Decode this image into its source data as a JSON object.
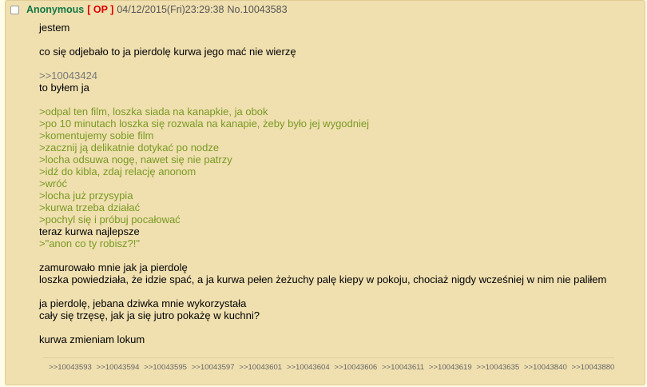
{
  "post": {
    "name": "Anonymous",
    "op_tag": "[ OP ]",
    "date": "04/12/2015(Fri)23:29:38",
    "number": "No.10043583"
  },
  "body": {
    "l1": "jestem",
    "l2": "co się odjebało to ja pierdolę kurwa jego mać nie wierzę",
    "quote": ">>10043424",
    "l3": "to byłem ja",
    "g1": ">odpal ten film, loszka siada na kanapkie, ja obok",
    "g2": ">po 10 minutach loszka się rozwala na kanapie, żeby było jej wygodniej",
    "g3": ">komentujemy sobie film",
    "g4": ">zacznij ją delikatnie dotykać po nodze",
    "g5": ">locha odsuwa nogę, nawet się nie patrzy",
    "g6": ">idź do kibla, zdaj relację anonom",
    "g7": ">wróć",
    "g8": ">locha już przysypia",
    "g9": ">kurwa trzeba działać",
    "g10": ">pochyl się i próbuj pocałować",
    "l4": "teraz kurwa najlepsze",
    "g11": ">\"anon co ty robisz?!\"",
    "l5": "zamurowało mnie jak ja pierdolę",
    "l6": "loszka powiedziała, że idzie spać, a ja kurwa pełen żeżuchy palę kiepy w pokoju, chociaż nigdy wcześniej w nim nie paliłem",
    "l7": "ja pierdolę, jebana dziwka mnie wykorzystała",
    "l8": "cały się trzęsę, jak ja się jutro pokażę w kuchni?",
    "l9": "kurwa zmieniam lokum"
  },
  "backlinks": [
    ">>10043593",
    ">>10043594",
    ">>10043595",
    ">>10043597",
    ">>10043601",
    ">>10043604",
    ">>10043606",
    ">>10043611",
    ">>10043619",
    ">>10043635",
    ">>10043840",
    ">>10043880"
  ],
  "colors": {
    "name": "#117743",
    "op": "#dd0000",
    "greentext": "#789922",
    "post_bg": "#f0e0b0"
  }
}
